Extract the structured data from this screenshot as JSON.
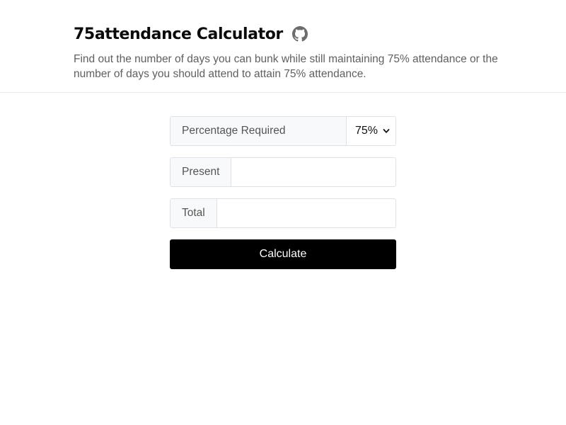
{
  "header": {
    "title": "75attendance Calculator",
    "github_icon": "github-icon",
    "subtitle": "Find out the number of days you can bunk while still maintaining 75% attendance or the number of days you should attend to attain 75% attendance."
  },
  "form": {
    "percentage": {
      "label": "Percentage Required",
      "selected": "75%",
      "icon": "chevron-down-icon"
    },
    "present": {
      "label": "Present",
      "value": "",
      "placeholder": ""
    },
    "total": {
      "label": "Total",
      "value": "",
      "placeholder": ""
    },
    "calculate_label": "Calculate"
  },
  "colors": {
    "button_bg": "#000000",
    "button_text": "#ffffff",
    "label_bg": "#f8f9fa",
    "border": "#dee2e6"
  }
}
